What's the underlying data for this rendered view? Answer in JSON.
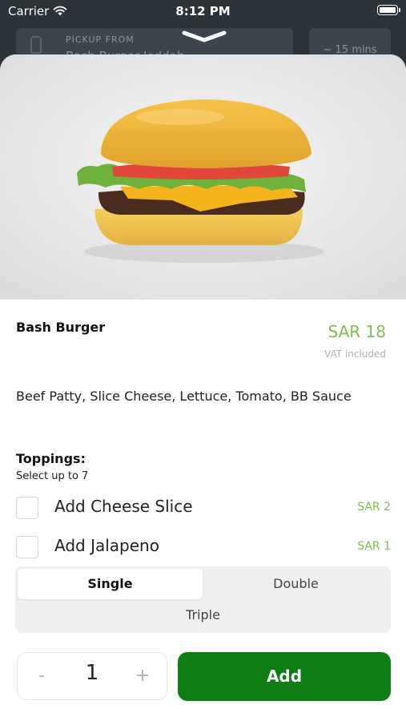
{
  "status_bar": {
    "carrier": "Carrier",
    "time": "8:12 PM"
  },
  "header": {
    "pickup_label": "PICKUP FROM",
    "pickup_value": "Bash Burger Jeddah",
    "eta": "~ 15 mins"
  },
  "product": {
    "name": "Bash Burger",
    "price": "SAR 18",
    "vat_note": "VAT included",
    "description": "Beef Patty, Slice Cheese, Lettuce, Tomato, BB Sauce"
  },
  "toppings": {
    "title": "Toppings:",
    "subtitle": "Select up to 7",
    "items": [
      {
        "label": "Add Cheese Slice",
        "price": "SAR 2",
        "checked": false
      },
      {
        "label": "Add Jalapeno",
        "price": "SAR 1",
        "checked": false
      }
    ]
  },
  "size_options": {
    "selected": "Single",
    "options": [
      "Single",
      "Double",
      "Triple"
    ]
  },
  "quantity": {
    "minus": "-",
    "value": "1",
    "plus": "+"
  },
  "add_button": {
    "label": "Add"
  },
  "colors": {
    "price_green": "#7bbf4e",
    "add_button": "#0e7e14",
    "background_dark": "#2b3338"
  },
  "icons": {
    "wifi": "wifi-icon",
    "battery": "battery-icon",
    "chevron": "chevron-down-icon",
    "pickup": "pickup-bag-icon"
  }
}
